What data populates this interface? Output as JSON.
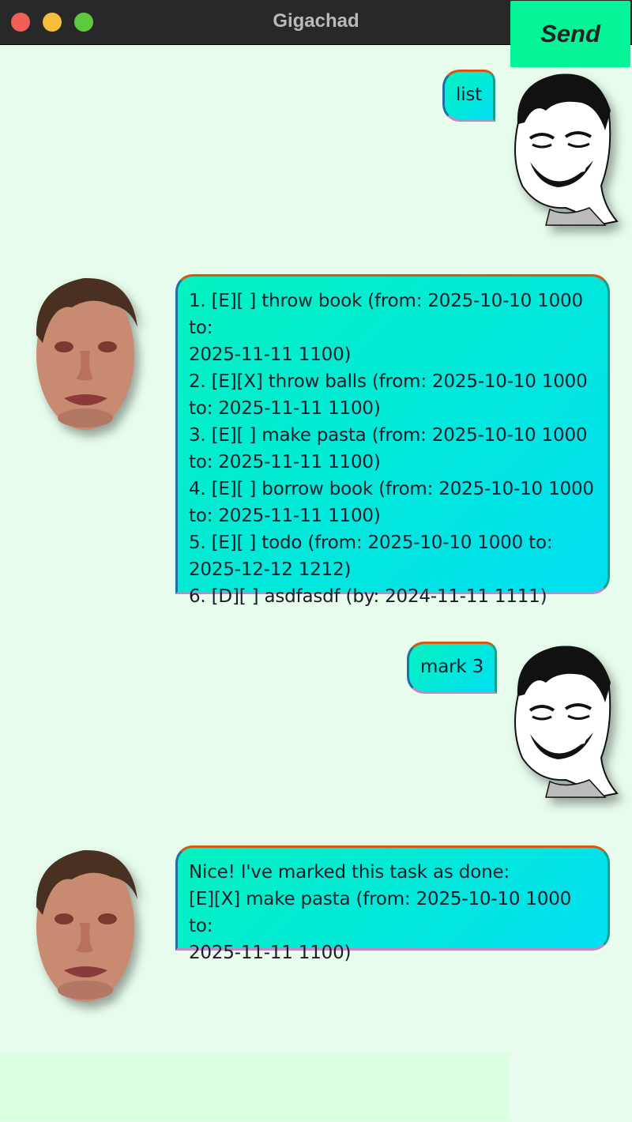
{
  "window": {
    "title": "Gigachad"
  },
  "messages": [
    {
      "sender": "user",
      "text": "list",
      "avatar_icon": "laughing-meme-face-icon"
    },
    {
      "sender": "bot",
      "text": "1. [E][ ] throw book (from: 2025-10-10 1000 to:\n2025-11-11 1100)\n2. [E][X] throw balls (from: 2025-10-10 1000\nto: 2025-11-11 1100)\n3. [E][ ] make pasta (from: 2025-10-10 1000\nto: 2025-11-11 1100)\n4. [E][ ] borrow book (from: 2025-10-10 1000\nto: 2025-11-11 1100)\n5. [E][ ] todo (from: 2025-10-10 1000 to:\n2025-12-12 1212)\n6. [D][ ] asdfasdf (by: 2024-11-11 1111)",
      "avatar_icon": "crying-face-icon"
    },
    {
      "sender": "user",
      "text": "mark 3",
      "avatar_icon": "laughing-meme-face-icon"
    },
    {
      "sender": "bot",
      "text": "Nice! I've marked this task as done:\n[E][X] make pasta (from: 2025-10-10 1000 to:\n2025-11-11 1100)",
      "avatar_icon": "crying-face-icon"
    }
  ],
  "input": {
    "value": "",
    "placeholder": ""
  },
  "send_button": {
    "label": "Send"
  },
  "colors": {
    "background": "#e7fcec",
    "bubble_gradient_start": "#05f2c0",
    "bubble_gradient_end": "#00dff2",
    "input_background": "#d9ffde",
    "send_button": "#04f497",
    "titlebar": "#282828"
  }
}
